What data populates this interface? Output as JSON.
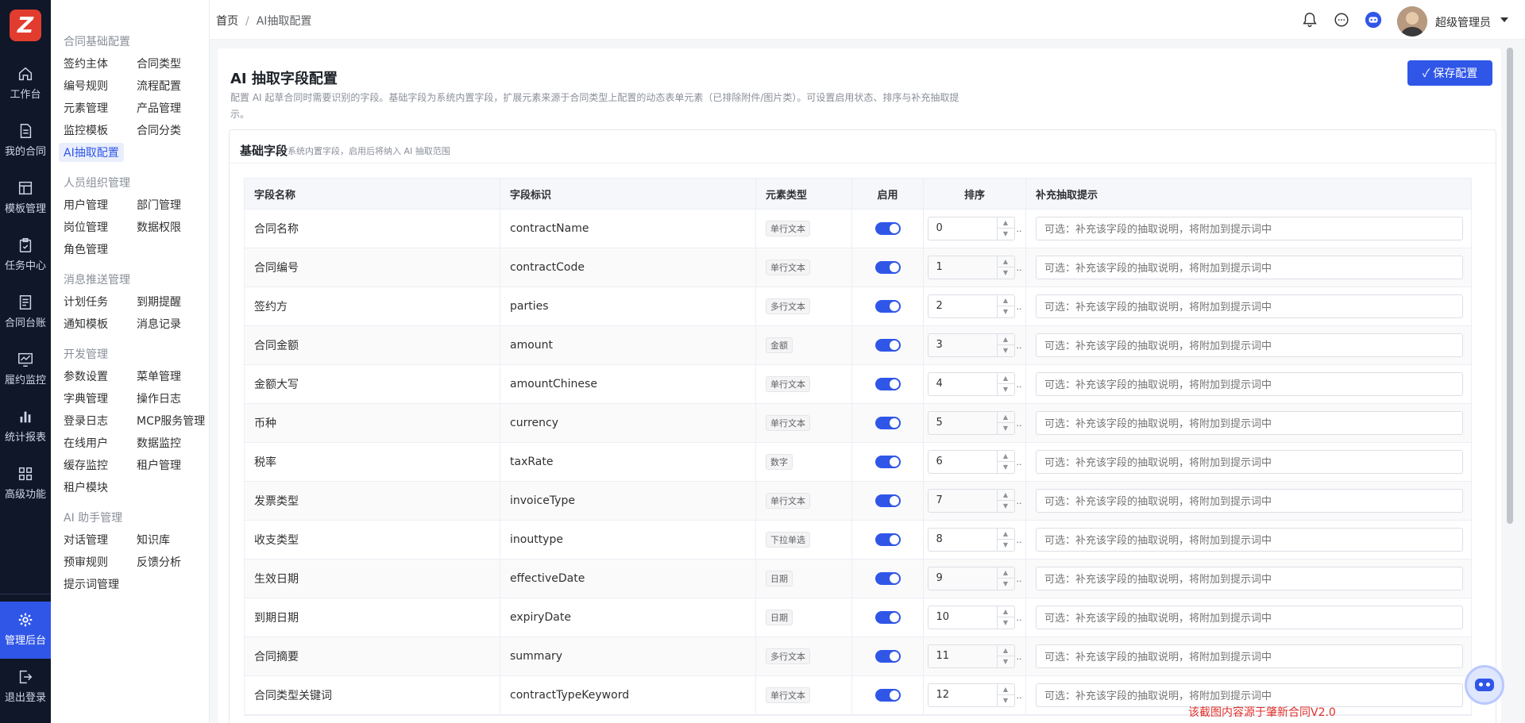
{
  "rail": {
    "logo": "Z",
    "items": [
      {
        "label": "工作台",
        "icon": "home-icon"
      },
      {
        "label": "我的合同",
        "icon": "document-icon"
      },
      {
        "label": "模板管理",
        "icon": "layout-icon"
      },
      {
        "label": "任务中心",
        "icon": "clipboard-icon"
      },
      {
        "label": "合同台账",
        "icon": "ledger-icon"
      },
      {
        "label": "履约监控",
        "icon": "monitor-icon"
      },
      {
        "label": "统计报表",
        "icon": "bar-chart-icon"
      },
      {
        "label": "高级功能",
        "icon": "grid-icon"
      },
      {
        "label": "管理后台",
        "icon": "gear-icon",
        "active": true
      },
      {
        "label": "退出登录",
        "icon": "logout-icon"
      }
    ]
  },
  "submenu": {
    "groups": [
      {
        "title": "合同基础配置",
        "items": [
          "签约主体",
          "合同类型",
          "编号规则",
          "流程配置",
          "元素管理",
          "产品管理",
          "监控模板",
          "合同分类",
          "AI抽取配置"
        ]
      },
      {
        "title": "人员组织管理",
        "items": [
          "用户管理",
          "部门管理",
          "岗位管理",
          "数据权限",
          "角色管理"
        ]
      },
      {
        "title": "消息推送管理",
        "items": [
          "计划任务",
          "到期提醒",
          "通知模板",
          "消息记录"
        ]
      },
      {
        "title": "开发管理",
        "items": [
          "参数设置",
          "菜单管理",
          "字典管理",
          "操作日志",
          "登录日志",
          "MCP服务管理",
          "在线用户",
          "数据监控",
          "缓存监控",
          "租户管理",
          "租户模块"
        ]
      },
      {
        "title": "AI 助手管理",
        "items": [
          "对话管理",
          "知识库",
          "预审规则",
          "反馈分析",
          "提示词管理"
        ]
      }
    ],
    "active_item": "AI抽取配置"
  },
  "header": {
    "breadcrumb": {
      "home": "首页",
      "separator": "/",
      "current": "AI抽取配置"
    },
    "icons": [
      "bell-icon",
      "chat-icon",
      "robot-icon"
    ],
    "user_name": "超级管理员"
  },
  "page": {
    "title": "AI 抽取字段配置",
    "description": "配置 AI 起草合同时需要识别的字段。基础字段为系统内置字段，扩展元素来源于合同类型上配置的动态表单元素（已排除附件/图片类）。可设置启用状态、排序与补充抽取提示。",
    "save_label": "保存配置",
    "accent_color": "#3056e8"
  },
  "card": {
    "title": "基础字段",
    "subtitle": "系统内置字段，启用后将纳入 AI 抽取范围"
  },
  "table": {
    "columns": [
      "字段名称",
      "字段标识",
      "元素类型",
      "启用",
      "排序",
      "补充抽取提示"
    ],
    "hint_placeholder": "可选：补充该字段的抽取说明，将附加到提示词中",
    "rows": [
      {
        "name": "合同名称",
        "key": "contractName",
        "type": "单行文本",
        "enabled": true,
        "order": "0"
      },
      {
        "name": "合同编号",
        "key": "contractCode",
        "type": "单行文本",
        "enabled": true,
        "order": "1"
      },
      {
        "name": "签约方",
        "key": "parties",
        "type": "多行文本",
        "enabled": true,
        "order": "2"
      },
      {
        "name": "合同金额",
        "key": "amount",
        "type": "金额",
        "enabled": true,
        "order": "3"
      },
      {
        "name": "金额大写",
        "key": "amountChinese",
        "type": "单行文本",
        "enabled": true,
        "order": "4"
      },
      {
        "name": "币种",
        "key": "currency",
        "type": "单行文本",
        "enabled": true,
        "order": "5"
      },
      {
        "name": "税率",
        "key": "taxRate",
        "type": "数字",
        "enabled": true,
        "order": "6"
      },
      {
        "name": "发票类型",
        "key": "invoiceType",
        "type": "单行文本",
        "enabled": true,
        "order": "7"
      },
      {
        "name": "收支类型",
        "key": "inouttype",
        "type": "下拉单选",
        "enabled": true,
        "order": "8"
      },
      {
        "name": "生效日期",
        "key": "effectiveDate",
        "type": "日期",
        "enabled": true,
        "order": "9"
      },
      {
        "name": "到期日期",
        "key": "expiryDate",
        "type": "日期",
        "enabled": true,
        "order": "10"
      },
      {
        "name": "合同摘要",
        "key": "summary",
        "type": "多行文本",
        "enabled": true,
        "order": "11"
      },
      {
        "name": "合同类型关键词",
        "key": "contractTypeKeyword",
        "type": "单行文本",
        "enabled": true,
        "order": "12"
      }
    ]
  },
  "source_note": "该截图内容源于肇新合同V2.0"
}
